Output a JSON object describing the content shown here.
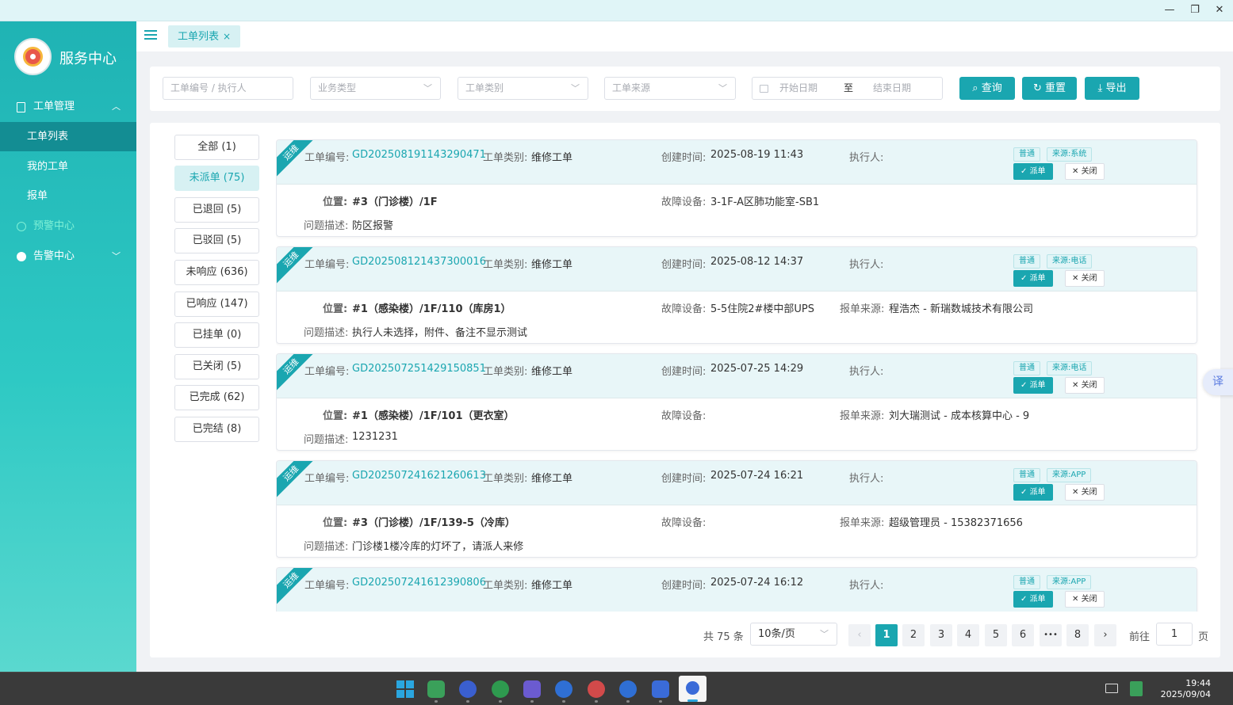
{
  "window": {
    "minimize_icon": "minimize-icon",
    "restore_icon": "restore-icon",
    "close_icon": "close-icon"
  },
  "sidebar": {
    "brand": "服务中心",
    "groups": [
      {
        "label": "工单管理",
        "expanded": true
      },
      {
        "label": "预警中心"
      },
      {
        "label": "告警中心"
      }
    ],
    "items": [
      {
        "label": "工单列表",
        "active": true
      },
      {
        "label": "我的工单"
      },
      {
        "label": "报单"
      }
    ]
  },
  "topbar": {
    "tab_label": "工单列表",
    "tab_close": "×"
  },
  "filters": {
    "order_placeholder": "工单编号 / 执行人",
    "business_type": "业务类型",
    "order_category": "工单类别",
    "order_source": "工单来源",
    "start_date": "开始日期",
    "range_sep": "至",
    "end_date": "结束日期",
    "search_btn": "查询",
    "reset_btn": "重置",
    "export_btn": "导出"
  },
  "statuses": [
    {
      "label": "全部 (1)"
    },
    {
      "label": "未派单 (75)",
      "active": true
    },
    {
      "label": "已退回 (5)"
    },
    {
      "label": "已驳回 (5)"
    },
    {
      "label": "未响应 (636)"
    },
    {
      "label": "已响应 (147)"
    },
    {
      "label": "已挂单 (0)"
    },
    {
      "label": "已关闭 (5)"
    },
    {
      "label": "已完成 (62)"
    },
    {
      "label": "已完结 (8)"
    }
  ],
  "labels": {
    "ribbon": "运维",
    "order_no": "工单编号:",
    "category": "工单类别:",
    "created": "创建时间:",
    "executor": "执行人:",
    "location": "位置:",
    "device": "故障设备:",
    "reporter": "报单来源:",
    "description": "问题描述:",
    "dispatch": "派单",
    "close": "关闭"
  },
  "orders": [
    {
      "no": "GD202508191143290471",
      "category": "维修工单",
      "created": "2025-08-19 11:43",
      "priority": "普通",
      "source": "来源:系统",
      "location": "#3（门诊楼）/1F",
      "device": "3-1F-A区肺功能室-SB1",
      "reporter": "",
      "description": "防区报警"
    },
    {
      "no": "GD202508121437300016",
      "category": "维修工单",
      "created": "2025-08-12 14:37",
      "priority": "普通",
      "source": "来源:电话",
      "location": "#1（感染楼）/1F/110（库房1）",
      "device": "5-5住院2#楼中部UPS",
      "reporter": "程浩杰 - 新瑞数城技术有限公司",
      "description": "执行人未选择，附件、备注不显示测试"
    },
    {
      "no": "GD202507251429150851",
      "category": "维修工单",
      "created": "2025-07-25 14:29",
      "priority": "普通",
      "source": "来源:电话",
      "location": "#1（感染楼）/1F/101（更衣室）",
      "device": "",
      "reporter": "刘大瑞测试 - 成本核算中心 - 9",
      "description": "1231231"
    },
    {
      "no": "GD202507241621260613",
      "category": "维修工单",
      "created": "2025-07-24 16:21",
      "priority": "普通",
      "source": "来源:APP",
      "location": "#3（门诊楼）/1F/139-5（冷库）",
      "device": "",
      "reporter": "超级管理员 - 15382371656",
      "description": "门诊楼1楼冷库的灯坏了，请派人来修"
    },
    {
      "no": "GD202507241612390806",
      "category": "维修工单",
      "created": "2025-07-24 16:12",
      "priority": "普通",
      "source": "来源:APP",
      "location": "",
      "device": "",
      "reporter": "",
      "description": ""
    }
  ],
  "pagination": {
    "total": "共 75 条",
    "page_size": "10条/页",
    "pages": [
      "1",
      "2",
      "3",
      "4",
      "5",
      "6",
      "•••",
      "8"
    ],
    "current": "1",
    "prev": "‹",
    "next": "›",
    "goto_label": "前往",
    "goto_value": "1",
    "page_suffix": "页"
  },
  "translate_label": "译",
  "taskbar": {
    "time": "19:44",
    "date": "2025/09/04",
    "icon_colors": [
      "#2aa6df",
      "#3aa05a",
      "#3a5fcf",
      "#2e9a4f",
      "#6b5bd0",
      "#2f6fd4",
      "#d24a4a",
      "#2f6fd4",
      "#3a6bd8",
      "#ffffff"
    ]
  }
}
